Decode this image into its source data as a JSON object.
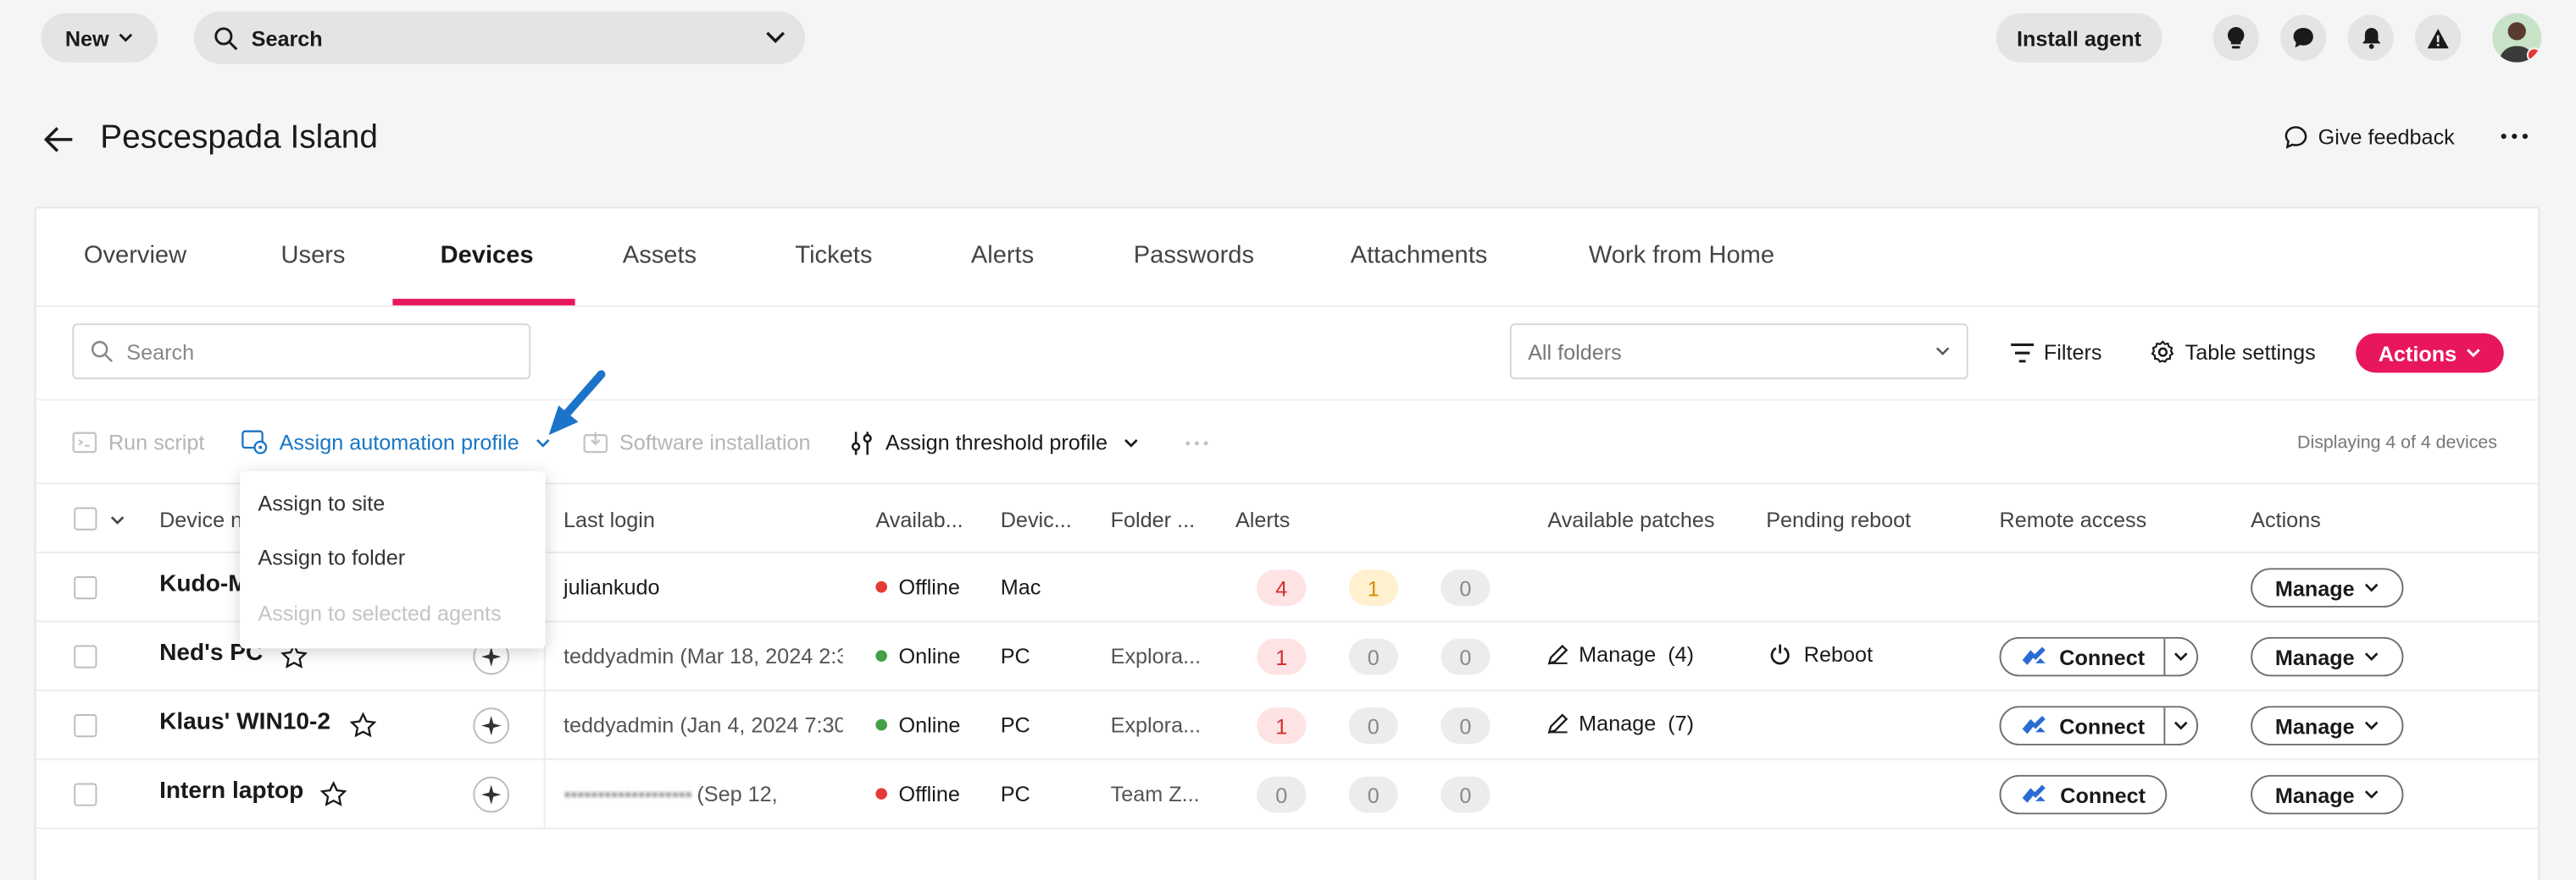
{
  "topbar": {
    "new_label": "New",
    "search_label": "Search",
    "install_agent_label": "Install agent",
    "icons": [
      "lightbulb-icon",
      "chat-icon",
      "bell-icon",
      "warning-icon"
    ]
  },
  "page": {
    "title": "Pescespada Island",
    "feedback_label": "Give feedback"
  },
  "tabs": [
    {
      "label": "Overview"
    },
    {
      "label": "Users"
    },
    {
      "label": "Devices",
      "active": true
    },
    {
      "label": "Assets"
    },
    {
      "label": "Tickets"
    },
    {
      "label": "Alerts"
    },
    {
      "label": "Passwords"
    },
    {
      "label": "Attachments"
    },
    {
      "label": "Work from Home"
    }
  ],
  "filters": {
    "search_placeholder": "Search",
    "folder_placeholder": "All folders",
    "filters_label": "Filters",
    "table_settings_label": "Table settings",
    "actions_label": "Actions"
  },
  "bulk": {
    "run_script": "Run script",
    "assign_automation": "Assign automation profile",
    "software_installation": "Software installation",
    "assign_threshold": "Assign threshold profile",
    "displaying": "Displaying 4 of 4 devices"
  },
  "dropdown": {
    "items": [
      "Assign to site",
      "Assign to folder",
      "Assign to selected agents"
    ]
  },
  "columns": {
    "device_name": "Device n",
    "last_login": "Last login",
    "availability": "Availab...",
    "device_type": "Devic...",
    "folder": "Folder ...",
    "alerts": "Alerts",
    "available_patches": "Available patches",
    "pending_reboot": "Pending reboot",
    "remote_access": "Remote access",
    "actions": "Actions"
  },
  "rows": [
    {
      "name": "Kudo-M",
      "last_login": "juliankudo",
      "status": "Offline",
      "type": "Mac",
      "folder": "",
      "alerts": [
        "4",
        "1",
        "0"
      ],
      "patches": "",
      "reboot": "",
      "connect": "",
      "manage": "Manage"
    },
    {
      "name": "Ned's PC",
      "last_login": "teddyadmin (Mar 18, 2024 2:3",
      "status": "Online",
      "type": "PC",
      "folder": "Explora...",
      "alerts": [
        "1",
        "0",
        "0"
      ],
      "patches": "Manage  (4)",
      "reboot": "Reboot",
      "connect": "Connect",
      "manage": "Manage"
    },
    {
      "name": "Klaus' WIN10-2",
      "last_login": "teddyadmin (Jan 4, 2024 7:30",
      "status": "Online",
      "type": "PC",
      "folder": "Explora...",
      "alerts": [
        "1",
        "0",
        "0"
      ],
      "patches": "Manage  (7)",
      "reboot": "",
      "connect": "Connect",
      "manage": "Manage"
    },
    {
      "name": "Intern laptop",
      "last_login": "(Sep 12,",
      "status": "Offline",
      "type": "PC",
      "folder": "Team Z...",
      "alerts": [
        "0",
        "0",
        "0"
      ],
      "patches": "",
      "reboot": "",
      "connect": "Connect",
      "manage": "Manage"
    }
  ],
  "colors": {
    "accent": "#e8175d",
    "link_blue": "#1976c4",
    "online": "#43a047",
    "offline": "#e53935"
  }
}
